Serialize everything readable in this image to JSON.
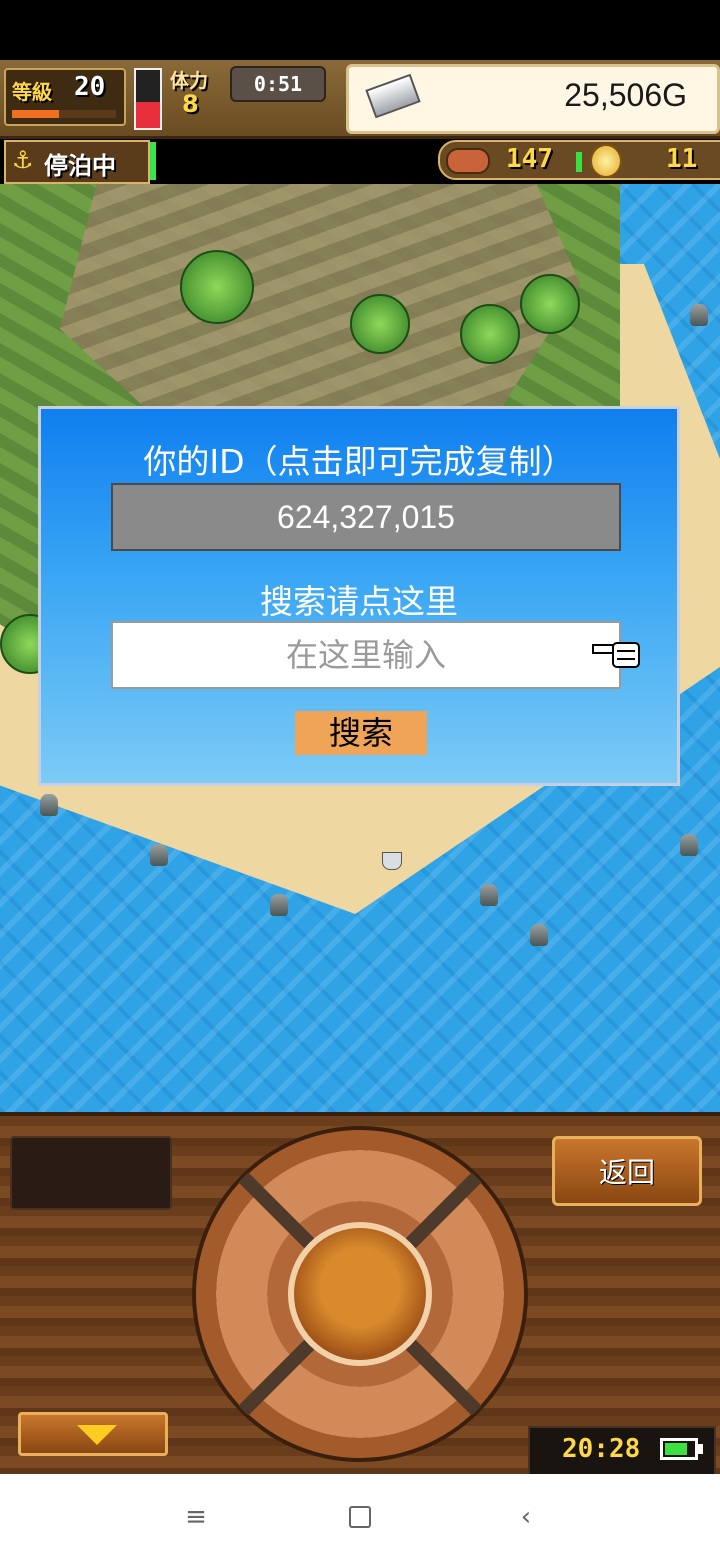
{
  "hud": {
    "level_label": "等級",
    "level": "20",
    "xp_progress": 0.45,
    "stamina_label": "体力",
    "stamina": "8",
    "stamina_fill": 0.45,
    "timer": "0:51",
    "money": "25,506G",
    "status_label": "停泊中",
    "food_count": "147",
    "coin_count": "11"
  },
  "dialog": {
    "title": "你的ID（点击即可完成复制）",
    "id_value": "624,327,015",
    "search_label": "搜索请点这里",
    "search_placeholder": "在这里输入",
    "search_button": "搜索"
  },
  "panel": {
    "back_label": "返回",
    "clock": "20:28",
    "battery_level": 0.8
  },
  "navbar": {
    "menu_icon": "≡",
    "back_icon": "‹"
  },
  "colors": {
    "dialog_top": "#0f7ff0",
    "dialog_bottom": "#7ccbf6",
    "search_button": "#f0a458",
    "sea": "#2fa3e6"
  }
}
